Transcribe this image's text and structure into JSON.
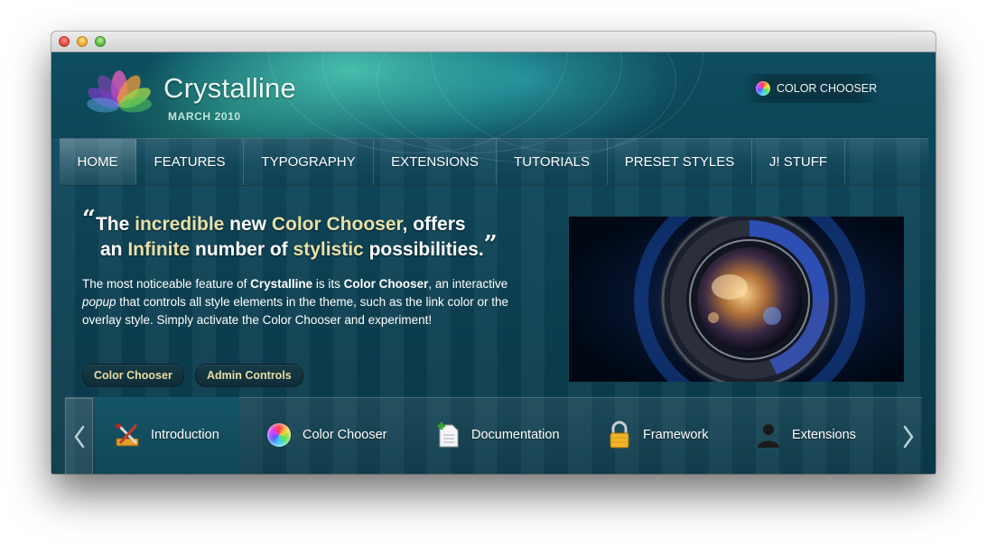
{
  "site": {
    "title": "Crystalline",
    "subtitle": "MARCH 2010",
    "color_chooser_label": "COLOR CHOOSER"
  },
  "nav": {
    "items": [
      {
        "label": "HOME",
        "active": true
      },
      {
        "label": "FEATURES"
      },
      {
        "label": "TYPOGRAPHY"
      },
      {
        "label": "EXTENSIONS"
      },
      {
        "label": "TUTORIALS"
      },
      {
        "label": "PRESET STYLES"
      },
      {
        "label": "J! STUFF"
      }
    ]
  },
  "feature": {
    "quote_open": "“",
    "quote_close": "”",
    "quote_parts": {
      "p1": "The ",
      "h1": "incredible",
      "p2": " new ",
      "h2": "Color Chooser",
      "p3": ", offers",
      "p4": "an ",
      "h3": "Infinite",
      "p5": " number of ",
      "h4": "stylistic",
      "p6": " possibilities."
    },
    "body": {
      "t1": "The most noticeable feature of ",
      "b1": "Crystalline",
      "t2": " is its ",
      "b2": "Color Chooser",
      "t3": ", an interactive ",
      "i1": "popup",
      "t4": " that controls all style elements in the theme, such as the link color or the overlay style. Simply activate the Color Chooser and experiment!"
    },
    "buttons": [
      "Color Chooser",
      "Admin Controls"
    ]
  },
  "tabs": {
    "items": [
      {
        "label": "Introduction",
        "icon": "tools-icon",
        "active": true
      },
      {
        "label": "Color Chooser",
        "icon": "color-ball-icon"
      },
      {
        "label": "Documentation",
        "icon": "document-add-icon"
      },
      {
        "label": "Framework",
        "icon": "padlock-icon"
      },
      {
        "label": "Extensions",
        "icon": "user-silhouette-icon"
      }
    ]
  },
  "colors": {
    "page_bg": "#0e4658",
    "highlight_text": "#eadfa6",
    "nav_text": "#ffffff"
  }
}
